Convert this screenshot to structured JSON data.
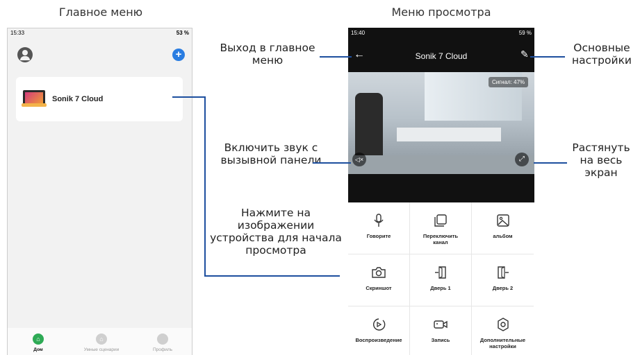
{
  "captions": {
    "left": "Главное меню",
    "right": "Меню просмотра"
  },
  "home": {
    "status_time": "15:33",
    "status_battery": "53 %",
    "device_name": "Sonik 7 Cloud",
    "nav": [
      {
        "label": "Дом",
        "icon": "home-icon",
        "active": true
      },
      {
        "label": "Умные сценарии",
        "icon": "smart-scene-icon",
        "active": false
      },
      {
        "label": "Профиль",
        "icon": "profile-icon",
        "active": false
      }
    ]
  },
  "viewer": {
    "status_time": "15:40",
    "status_battery": "59 %",
    "title": "Sonik 7 Cloud",
    "signal": "Сигнал: 47%",
    "tiles": [
      {
        "label": "Говорите",
        "icon": "microphone-icon"
      },
      {
        "label": "Переключить канал",
        "icon": "switch-channel-icon"
      },
      {
        "label": "альбом",
        "icon": "album-icon"
      },
      {
        "label": "Скриншот",
        "icon": "camera-icon"
      },
      {
        "label": "Дверь 1",
        "icon": "door-1-icon"
      },
      {
        "label": "Дверь 2",
        "icon": "door-2-icon"
      },
      {
        "label": "Воспроизведение",
        "icon": "playback-icon"
      },
      {
        "label": "Запись",
        "icon": "record-icon"
      },
      {
        "label": "Дополнительные настройки",
        "icon": "settings-icon"
      }
    ]
  },
  "notes": {
    "exit": "Выход в главное меню",
    "settings": "Основные настройки",
    "sound": "Включить звук с вызывной панели",
    "fullscreen": "Растянуть на весь экран",
    "tap_device": "Нажмите на изображении устройства для начала просмотра"
  },
  "colors": {
    "accent_blue": "#2a7de1",
    "active_green": "#2eaa55",
    "line_blue": "#1c4e9e",
    "header_black": "#111111"
  }
}
